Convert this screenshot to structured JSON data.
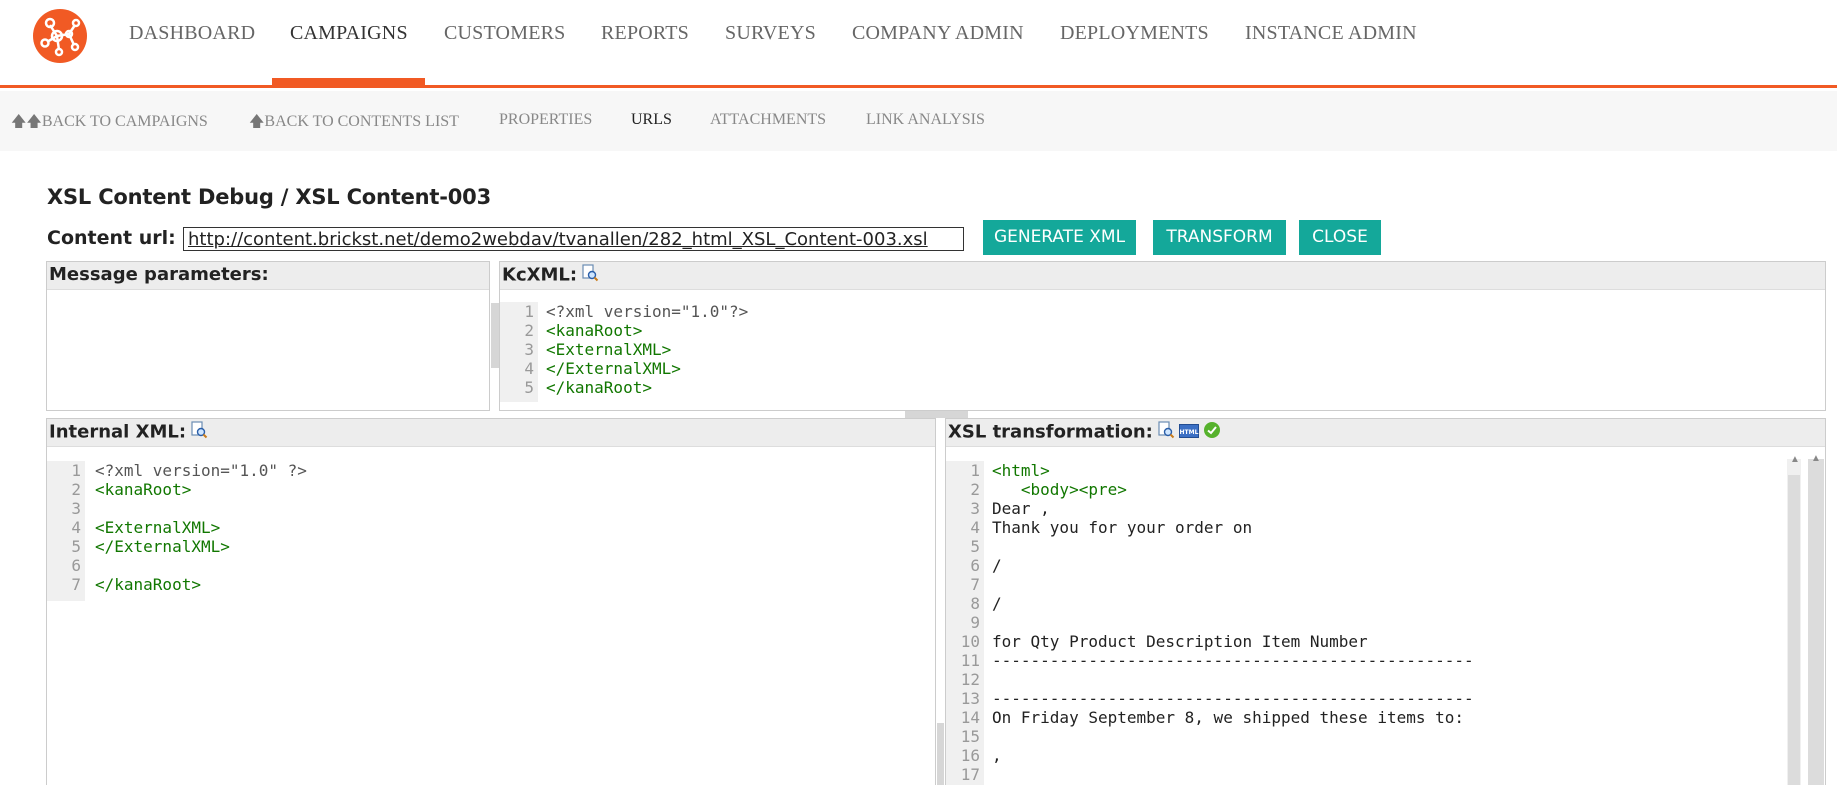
{
  "nav": {
    "items": [
      {
        "label": "DASHBOARD"
      },
      {
        "label": "CAMPAIGNS",
        "active": true
      },
      {
        "label": "CUSTOMERS"
      },
      {
        "label": "REPORTS"
      },
      {
        "label": "SURVEYS"
      },
      {
        "label": "COMPANY ADMIN"
      },
      {
        "label": "DEPLOYMENTS"
      },
      {
        "label": "INSTANCE ADMIN"
      }
    ],
    "accent": "#f15a24"
  },
  "subnav": {
    "items": [
      {
        "label": "BACK TO CAMPAIGNS"
      },
      {
        "label": "BACK TO CONTENTS LIST"
      },
      {
        "label": "PROPERTIES"
      },
      {
        "label": "URLS",
        "active": true
      },
      {
        "label": "ATTACHMENTS"
      },
      {
        "label": "LINK ANALYSIS"
      }
    ]
  },
  "page": {
    "title": "XSL Content Debug / XSL Content-003",
    "url_label": "Content url:",
    "url_value": "http://content.brickst.net/demo2webdav/tvanallen/282_html_XSL_Content-003.xsl",
    "buttons": {
      "generate": "GENERATE XML",
      "transform": "TRANSFORM",
      "close": "CLOSE"
    },
    "button_color": "#14a89a"
  },
  "panels": {
    "message_params": {
      "title": "Message parameters:"
    },
    "kcxml": {
      "title": "KcXML:",
      "lines": [
        {
          "n": "1",
          "text": "<?xml version=\"1.0\"?>"
        },
        {
          "n": "2",
          "text": "<kanaRoot>"
        },
        {
          "n": "3",
          "text": "<ExternalXML>"
        },
        {
          "n": "4",
          "text": "</ExternalXML>"
        },
        {
          "n": "5",
          "text": "</kanaRoot>"
        }
      ]
    },
    "internal_xml": {
      "title": "Internal XML:",
      "lines": [
        {
          "n": "1",
          "text": "<?xml version=\"1.0\" ?>"
        },
        {
          "n": "2",
          "text": "<kanaRoot>"
        },
        {
          "n": "3",
          "text": ""
        },
        {
          "n": "4",
          "text": "<ExternalXML>"
        },
        {
          "n": "5",
          "text": "</ExternalXML>"
        },
        {
          "n": "6",
          "text": ""
        },
        {
          "n": "7",
          "text": "</kanaRoot>"
        }
      ]
    },
    "xsl_transform": {
      "title": "XSL transformation:",
      "lines": [
        {
          "n": "1",
          "text": "<html>"
        },
        {
          "n": "2",
          "text": "   <body><pre>"
        },
        {
          "n": "3",
          "text": "Dear ,"
        },
        {
          "n": "4",
          "text": "Thank you for your order on"
        },
        {
          "n": "5",
          "text": ""
        },
        {
          "n": "6",
          "text": "/"
        },
        {
          "n": "7",
          "text": ""
        },
        {
          "n": "8",
          "text": "/"
        },
        {
          "n": "9",
          "text": ""
        },
        {
          "n": "10",
          "text": "for Qty Product Description Item Number"
        },
        {
          "n": "11",
          "text": "--------------------------------------------------"
        },
        {
          "n": "12",
          "text": ""
        },
        {
          "n": "13",
          "text": "--------------------------------------------------"
        },
        {
          "n": "14",
          "text": "On Friday September 8, we shipped these items to:"
        },
        {
          "n": "15",
          "text": ""
        },
        {
          "n": "16",
          "text": ","
        },
        {
          "n": "17",
          "text": ""
        }
      ]
    }
  }
}
